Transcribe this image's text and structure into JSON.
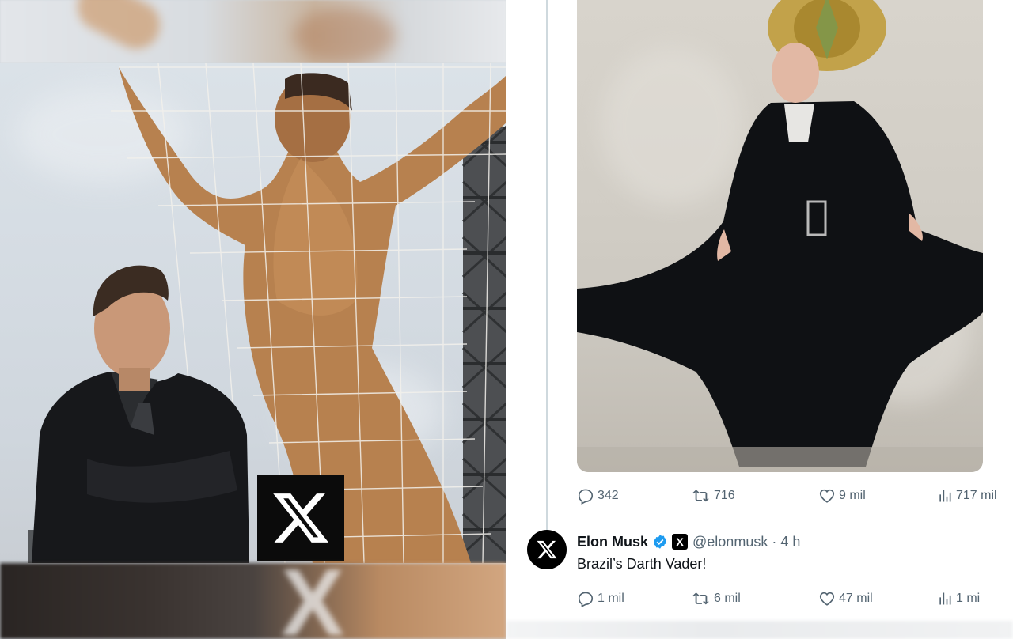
{
  "left_collage": {
    "x_logo": "X"
  },
  "tweet_image_post": {
    "stats": {
      "replies": "342",
      "reposts": "716",
      "likes": "9 mil",
      "views": "717 mil"
    }
  },
  "tweet_reply": {
    "avatar_letter": "X",
    "author_name": "Elon Musk",
    "affiliate_badge": "X",
    "handle_time": "@elonmusk · 4 h",
    "text": "Brazil’s Darth Vader!",
    "stats": {
      "replies": "1 mil",
      "reposts": "6 mil",
      "likes": "47 mil",
      "views": "1 mi"
    }
  },
  "icons": {
    "reply": "speech-bubble-icon",
    "repost": "repost-arrows-icon",
    "like": "heart-icon",
    "views": "bar-chart-icon",
    "verified": "verified-badge-icon"
  },
  "colors": {
    "text_primary": "#0f1419",
    "text_secondary": "#536471",
    "verified_blue": "#1d9bf0",
    "thread_line": "#cfd9de"
  }
}
